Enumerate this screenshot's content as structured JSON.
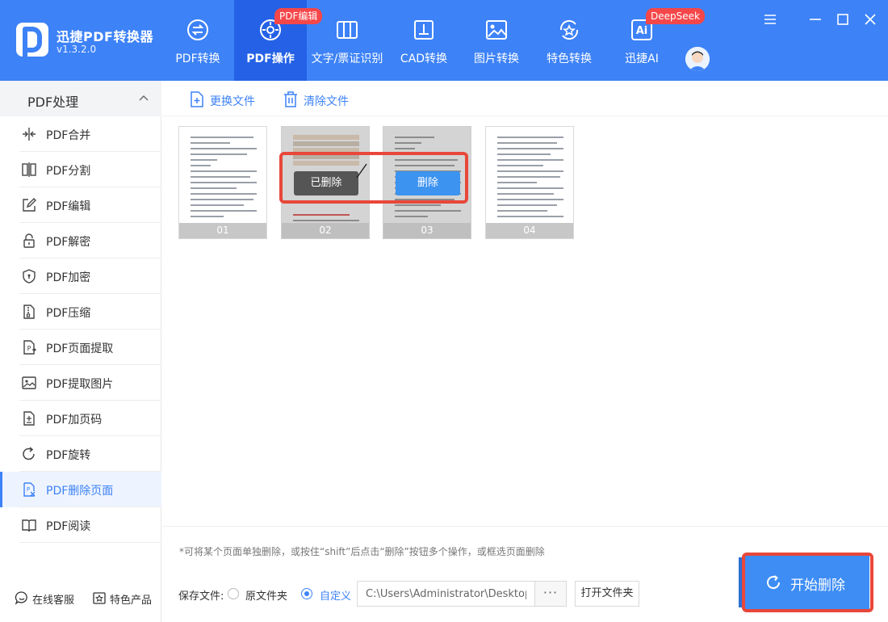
{
  "app": {
    "name": "迅捷PDF转换器",
    "version": "v1.3.2.0"
  },
  "nav": {
    "tabs": [
      {
        "label": "PDF转换",
        "icon": "pdf-convert-icon"
      },
      {
        "label": "PDF操作",
        "icon": "pdf-operate-icon",
        "badge": "PDF编辑"
      },
      {
        "label": "文字/票证识别",
        "icon": "ocr-icon"
      },
      {
        "label": "CAD转换",
        "icon": "cad-icon"
      },
      {
        "label": "图片转换",
        "icon": "image-icon"
      },
      {
        "label": "特色转换",
        "icon": "star-convert-icon"
      },
      {
        "label": "迅捷AI",
        "icon": "ai-icon",
        "badge": "DeepSeek"
      }
    ],
    "active_index": 1
  },
  "sidebar": {
    "header": "PDF处理",
    "items": [
      {
        "label": "PDF合并",
        "icon": "merge-icon"
      },
      {
        "label": "PDF分割",
        "icon": "split-icon"
      },
      {
        "label": "PDF编辑",
        "icon": "edit-icon"
      },
      {
        "label": "PDF解密",
        "icon": "unlock-icon"
      },
      {
        "label": "PDF加密",
        "icon": "shield-icon"
      },
      {
        "label": "PDF压缩",
        "icon": "compress-icon"
      },
      {
        "label": "PDF页面提取",
        "icon": "page-extract-icon"
      },
      {
        "label": "PDF提取图片",
        "icon": "image-extract-icon"
      },
      {
        "label": "PDF加页码",
        "icon": "page-number-icon"
      },
      {
        "label": "PDF旋转",
        "icon": "rotate-icon"
      },
      {
        "label": "PDF删除页面",
        "icon": "delete-page-icon"
      },
      {
        "label": "PDF阅读",
        "icon": "read-icon"
      }
    ],
    "active_index": 10,
    "footer": {
      "service": "在线客服",
      "products": "特色产品"
    }
  },
  "toolbar": {
    "replace_file": "更换文件",
    "clear_file": "清除文件"
  },
  "pages": [
    {
      "number": "01",
      "state": "normal"
    },
    {
      "number": "02",
      "state": "deleted",
      "overlay": "已删除"
    },
    {
      "number": "03",
      "state": "hover",
      "overlay": "删除"
    },
    {
      "number": "04",
      "state": "normal"
    }
  ],
  "hint": "*可将某个页面单独删除，或按住“shift”后点击“删除”按钮多个操作，或框选页面删除",
  "save": {
    "label": "保存文件:",
    "option_original": "原文件夹",
    "option_custom": "自定义",
    "selected": "custom",
    "path": "C:\\Users\\Administrator\\Desktop",
    "more": "···",
    "open_folder": "打开文件夹"
  },
  "start_button": "开始删除",
  "colors": {
    "primary": "#3d82f7",
    "active_tab": "#2461e6",
    "badge": "#f5474a",
    "highlight_box": "#e8473a"
  }
}
